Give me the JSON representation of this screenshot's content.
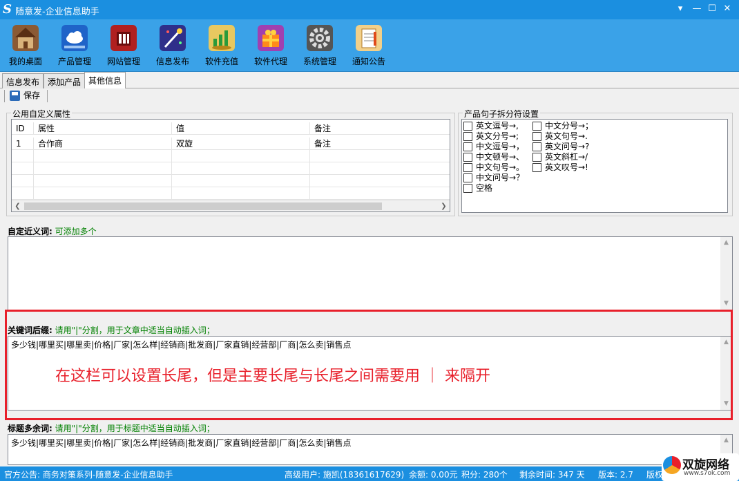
{
  "app": {
    "logo_letter": "S",
    "title": "随意发-企业信息助手",
    "controls": {
      "menu": "▾",
      "minimize": "—",
      "maximize": "☐",
      "close": "✕"
    }
  },
  "toolbar": {
    "items": [
      {
        "label": "我的桌面",
        "icon": "house-icon",
        "color": "#7a4a2a"
      },
      {
        "label": "产品管理",
        "icon": "cloud-icon",
        "color": "#1f63c8"
      },
      {
        "label": "网站管理",
        "icon": "server-icon",
        "color": "#b02020"
      },
      {
        "label": "信息发布",
        "icon": "magic-wand-icon",
        "color": "#3a3aa0"
      },
      {
        "label": "软件充值",
        "icon": "coins-chart-icon",
        "color": "#d8a020"
      },
      {
        "label": "软件代理",
        "icon": "gift-box-icon",
        "color": "#a040b0"
      },
      {
        "label": "系统管理",
        "icon": "gear-icon",
        "color": "#555555"
      },
      {
        "label": "通知公告",
        "icon": "notepad-icon",
        "color": "#e0a040"
      }
    ]
  },
  "tabs": [
    "信息发布",
    "添加产品",
    "其他信息"
  ],
  "subbar": {
    "save_label": "保存"
  },
  "attributes": {
    "title": "公用自定义属性",
    "columns": [
      "ID",
      "属性",
      "值",
      "备注"
    ],
    "rows": [
      [
        "1",
        "合作商",
        "双旋",
        "备注"
      ]
    ]
  },
  "splitter": {
    "title": "产品句子拆分符设置",
    "col1": [
      "英文逗号→,",
      "英文分号→;",
      "中文逗号→，",
      "中文顿号→、",
      "中文句号→。",
      "中文问号→？",
      "空格"
    ],
    "col2": [
      "中文分号→；",
      "英文句号→.",
      "英文问号→?",
      "英文斜杠→/",
      "英文叹号→!"
    ]
  },
  "synonyms": {
    "label": "自定近义词:",
    "hint": "可添加多个",
    "value": ""
  },
  "keyword_suffix": {
    "label": "关键词后缀:",
    "hint": "请用\"|\"分割，用于文章中适当自动插入词；",
    "value": "多少钱|哪里买|哪里卖|价格|厂家|怎么样|经销商|批发商|厂家直销|经营部|厂商|怎么卖|销售点"
  },
  "annotation": "在这栏可以设置长尾，但是主要长尾与长尾之间需要用 ｜ 来隔开",
  "title_extra": {
    "label": "标题多余词:",
    "hint": "请用\"|\"分割，用于标题中适当自动插入词；",
    "value": "多少钱|哪里买|哪里卖|价格|厂家|怎么样|经销商|批发商|厂家直销|经营部|厂商|怎么卖|销售点"
  },
  "status": {
    "notice": "官方公告: 商务对策系列-随意发-企业信息助手",
    "user": "高级用户: 施凯(18361617629)",
    "balance": "余额: 0.00元",
    "points": "积分: 280个",
    "remaining": "剩余时间: 347 天",
    "version": "版本: 2.7",
    "copyright": "版权"
  },
  "watermark": {
    "name": "双旋网络",
    "url": "www.s7ok.com"
  }
}
